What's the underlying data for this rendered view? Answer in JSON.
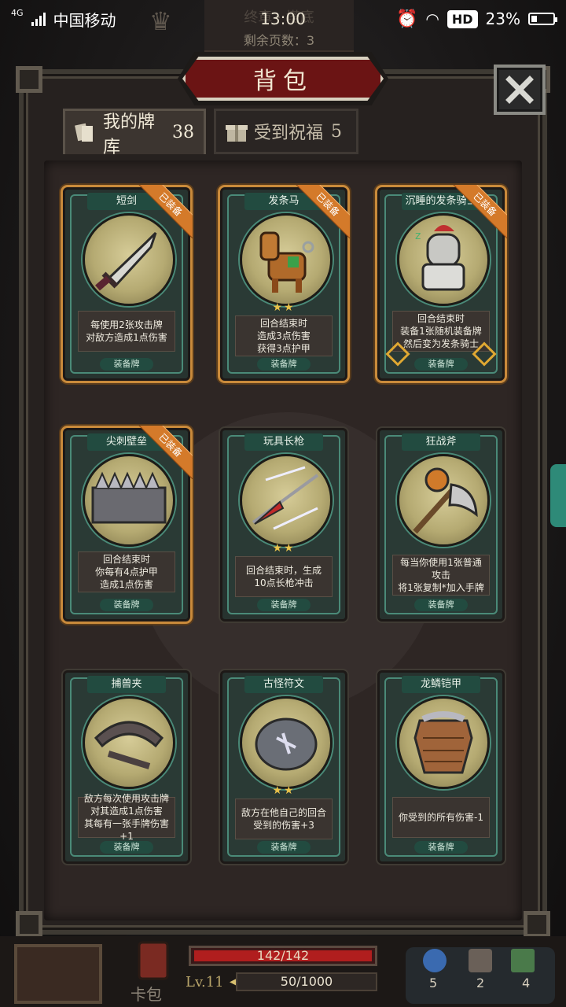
{
  "status_bar": {
    "network": "4G",
    "carrier": "中国移动",
    "time": "13:00",
    "hd": "HD",
    "battery": "23%"
  },
  "game_header": {
    "title": "终章 · 塔底",
    "pages": "剩余页数：3"
  },
  "panel": {
    "title": "背包",
    "close_label": "✕"
  },
  "tabs": [
    {
      "label": "我的牌库",
      "count": "38",
      "active": true
    },
    {
      "label": "受到祝福",
      "count": "5",
      "active": false
    }
  ],
  "cards": [
    {
      "name": "短剑",
      "equipped": true,
      "equipped_label": "已装备",
      "stars": "",
      "desc": "每使用2张攻击牌\n对敌方造成1点伤害",
      "type": "装备牌",
      "icon": "dagger-icon"
    },
    {
      "name": "发条马",
      "equipped": true,
      "equipped_label": "已装备",
      "stars": "★★",
      "desc": "回合结束时\n造成3点伤害\n获得3点护甲",
      "type": "装备牌",
      "icon": "wind-up-horse-icon"
    },
    {
      "name": "沉睡的发条骑士",
      "equipped": true,
      "equipped_label": "已装备",
      "stars": "",
      "desc": "回合结束时\n装备1张随机装备牌\n然后变为发条骑士",
      "type": "装备牌",
      "icon": "sleeping-knight-icon"
    },
    {
      "name": "尖刺壁垒",
      "equipped": true,
      "equipped_label": "已装备",
      "stars": "",
      "desc": "回合结束时\n你每有4点护甲\n造成1点伤害",
      "type": "装备牌",
      "icon": "spiked-wall-icon"
    },
    {
      "name": "玩具长枪",
      "equipped": false,
      "equipped_label": "",
      "stars": "★★",
      "desc": "回合结束时，生成\n10点长枪冲击",
      "type": "装备牌",
      "icon": "toy-lance-icon"
    },
    {
      "name": "狂战斧",
      "equipped": false,
      "equipped_label": "",
      "stars": "",
      "desc": "每当你使用1张普通攻击\n将1张复制*加入手牌",
      "type": "装备牌",
      "icon": "berserker-axe-icon"
    },
    {
      "name": "捕兽夹",
      "equipped": false,
      "equipped_label": "",
      "stars": "",
      "desc": "敌方每次使用攻击牌\n对其造成1点伤害\n其每有一张手牌伤害+1",
      "type": "装备牌",
      "icon": "bear-trap-icon"
    },
    {
      "name": "古怪符文",
      "equipped": false,
      "equipped_label": "",
      "stars": "★★",
      "desc": "敌方在他自己的回合\n受到的伤害+3",
      "type": "装备牌",
      "icon": "strange-rune-icon"
    },
    {
      "name": "龙鳞铠甲",
      "equipped": false,
      "equipped_label": "",
      "stars": "",
      "desc": "你受到的所有伤害-1",
      "type": "装备牌",
      "icon": "dragon-armor-icon"
    }
  ],
  "hud": {
    "hp": "142/142",
    "level": "Lv.11",
    "xp": "50/1000",
    "deck_label": "卡包",
    "res1": "5",
    "res2": "2",
    "res3": "4"
  }
}
